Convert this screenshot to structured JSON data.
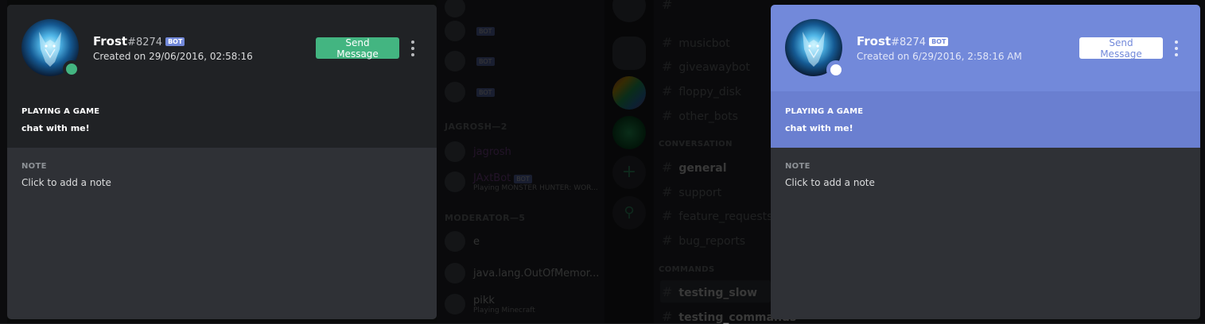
{
  "popout_dark": {
    "username": "Frost",
    "discriminator": "#8274",
    "badge": "BOT",
    "created": "Created on 29/06/2016, 02:58:16",
    "send_message": "Send Message",
    "activity_heading": "PLAYING A GAME",
    "activity_name": "chat with me!",
    "note_heading": "NOTE",
    "note_placeholder": "Click to add a note",
    "status_color": "#43b581"
  },
  "popout_blurple": {
    "username": "Frost",
    "discriminator": "#8274",
    "badge": "BOT",
    "created": "Created on 6/29/2016, 2:58:16 AM",
    "send_message": "Send Message",
    "activity_heading": "PLAYING A GAME",
    "activity_name": "chat with me!",
    "note_heading": "NOTE",
    "note_placeholder": "Click to add a note",
    "accent_color": "#7289da"
  },
  "background": {
    "members": {
      "headings": [
        "JAGROSH—2",
        "MODERATOR—5"
      ],
      "rows": [
        {
          "name": "",
          "bot": "BOT"
        },
        {
          "name": "",
          "bot": "BOT"
        },
        {
          "name": "",
          "bot": "BOT"
        },
        {
          "name": "jagrosh",
          "sub": ""
        },
        {
          "name": "JAxtBot",
          "sub": "Playing MONSTER HUNTER: WOR...",
          "bot": "BOT"
        },
        {
          "name": "e",
          "sub": ""
        },
        {
          "name": "java.lang.OutOfMemor...",
          "sub": ""
        },
        {
          "name": "pikk",
          "sub": "Playing Minecraft"
        }
      ]
    },
    "channels": {
      "top": [
        "musicbot",
        "giveawaybot",
        "floppy_disk",
        "other_bots"
      ],
      "cat_conversation": "CONVERSATION",
      "conversation": [
        "general",
        "support",
        "feature_requests",
        "bug_reports"
      ],
      "cat_commands": "COMMANDS",
      "commands": [
        "testing_slow",
        "testing_commands"
      ]
    }
  }
}
